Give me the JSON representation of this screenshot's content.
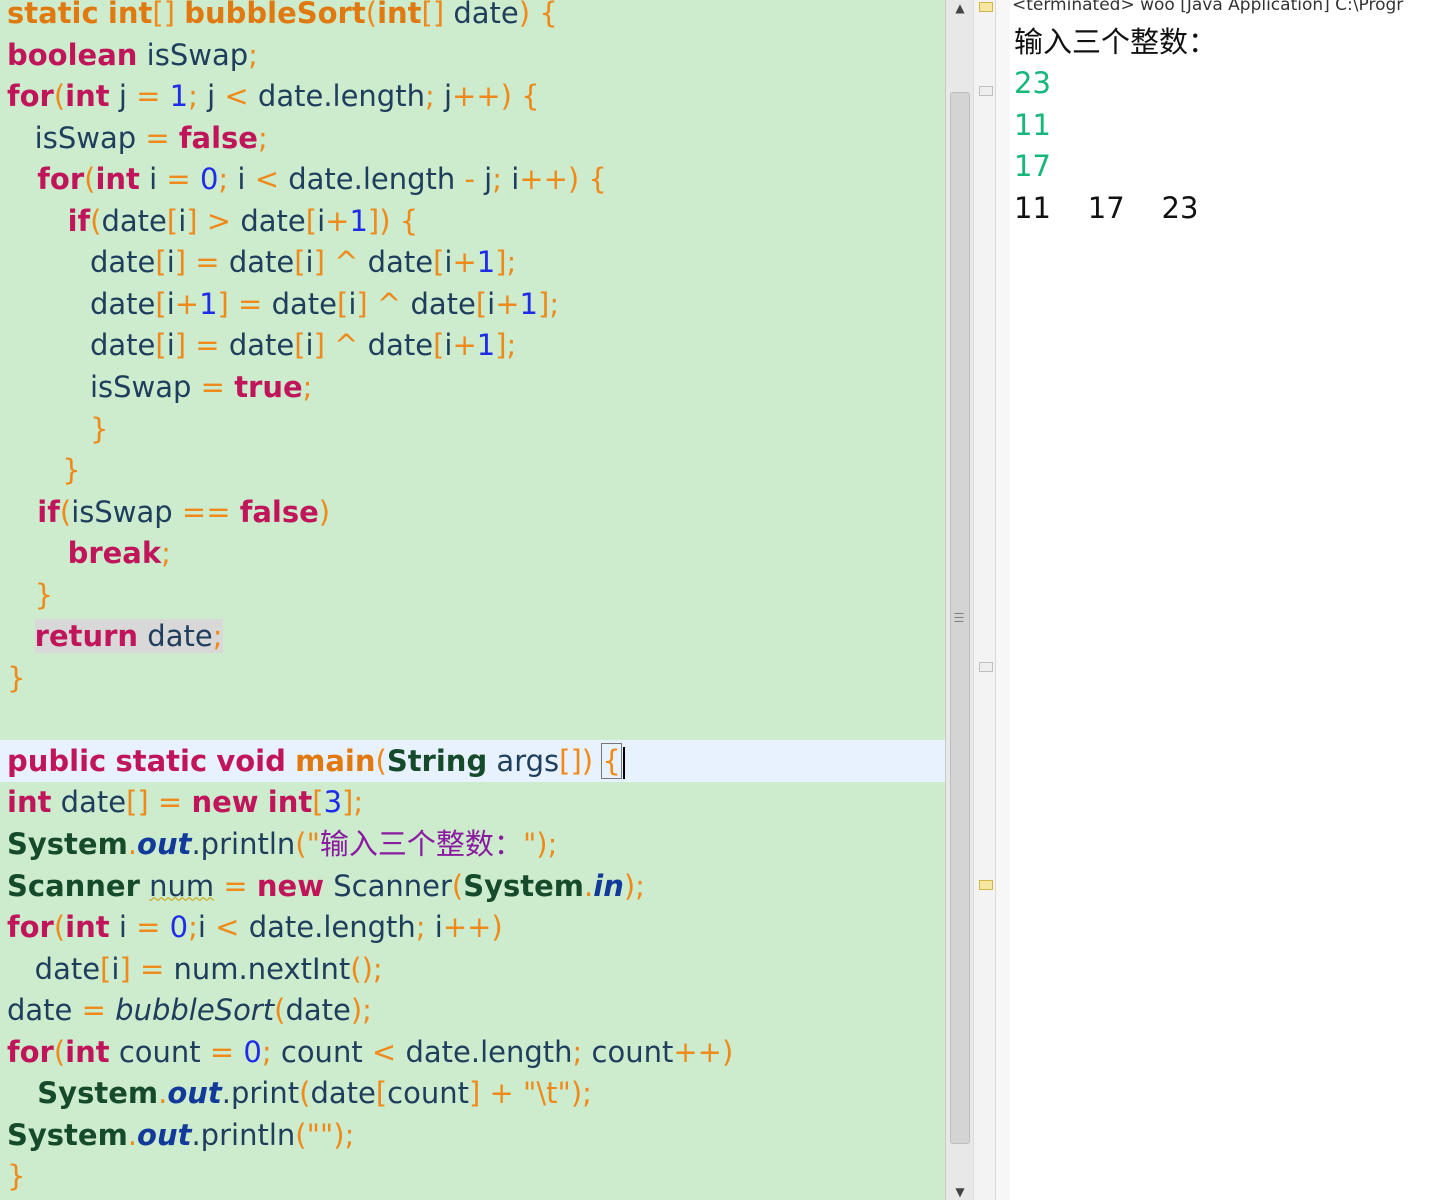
{
  "editor": {
    "lines": [
      [
        [
          "type",
          "static"
        ],
        [
          "p",
          " "
        ],
        [
          "type",
          "int"
        ],
        [
          "p",
          "[] "
        ],
        [
          "fn",
          "bubbleSort"
        ],
        [
          "p",
          "("
        ],
        [
          "type",
          "int"
        ],
        [
          "p",
          "[] "
        ],
        [
          "id",
          "date"
        ],
        [
          "p",
          ") {"
        ]
      ],
      [
        [
          "kw",
          "boolean"
        ],
        [
          "id",
          " isSwap"
        ],
        [
          "p",
          ";"
        ]
      ],
      [
        [
          "kw",
          "for"
        ],
        [
          "p",
          "("
        ],
        [
          "kw",
          "int"
        ],
        [
          "id",
          " j "
        ],
        [
          "p",
          "= "
        ],
        [
          "num",
          "1"
        ],
        [
          "p",
          "; "
        ],
        [
          "id",
          "j "
        ],
        [
          "p",
          "< "
        ],
        [
          "id",
          "date.length"
        ],
        [
          "p",
          "; "
        ],
        [
          "id",
          "j"
        ],
        [
          "p",
          "++) {"
        ]
      ],
      [
        [
          "id",
          "   isSwap "
        ],
        [
          "p",
          "= "
        ],
        [
          "kw",
          "false"
        ],
        [
          "p",
          ";"
        ]
      ],
      [
        [
          "kw",
          "   for"
        ],
        [
          "p",
          "("
        ],
        [
          "kw",
          "int"
        ],
        [
          "id",
          " i "
        ],
        [
          "p",
          "= "
        ],
        [
          "num",
          "0"
        ],
        [
          "p",
          "; "
        ],
        [
          "id",
          "i "
        ],
        [
          "p",
          "< "
        ],
        [
          "id",
          "date.length "
        ],
        [
          "p",
          "- "
        ],
        [
          "id",
          "j"
        ],
        [
          "p",
          "; "
        ],
        [
          "id",
          "i"
        ],
        [
          "p",
          "++) {"
        ]
      ],
      [
        [
          "kw",
          "      if"
        ],
        [
          "p",
          "("
        ],
        [
          "id",
          "date"
        ],
        [
          "p",
          "["
        ],
        [
          "id",
          "i"
        ],
        [
          "p",
          "] > "
        ],
        [
          "id",
          "date"
        ],
        [
          "p",
          "["
        ],
        [
          "id",
          "i"
        ],
        [
          "p",
          "+"
        ],
        [
          "num",
          "1"
        ],
        [
          "p",
          "]) {"
        ]
      ],
      [
        [
          "id",
          "         date"
        ],
        [
          "p",
          "["
        ],
        [
          "id",
          "i"
        ],
        [
          "p",
          "] = "
        ],
        [
          "id",
          "date"
        ],
        [
          "p",
          "["
        ],
        [
          "id",
          "i"
        ],
        [
          "p",
          "] ^ "
        ],
        [
          "id",
          "date"
        ],
        [
          "p",
          "["
        ],
        [
          "id",
          "i"
        ],
        [
          "p",
          "+"
        ],
        [
          "num",
          "1"
        ],
        [
          "p",
          "];"
        ]
      ],
      [
        [
          "id",
          "         date"
        ],
        [
          "p",
          "["
        ],
        [
          "id",
          "i"
        ],
        [
          "p",
          "+"
        ],
        [
          "num",
          "1"
        ],
        [
          "p",
          "] = "
        ],
        [
          "id",
          "date"
        ],
        [
          "p",
          "["
        ],
        [
          "id",
          "i"
        ],
        [
          "p",
          "] ^ "
        ],
        [
          "id",
          "date"
        ],
        [
          "p",
          "["
        ],
        [
          "id",
          "i"
        ],
        [
          "p",
          "+"
        ],
        [
          "num",
          "1"
        ],
        [
          "p",
          "];"
        ]
      ],
      [
        [
          "id",
          "         date"
        ],
        [
          "p",
          "["
        ],
        [
          "id",
          "i"
        ],
        [
          "p",
          "] = "
        ],
        [
          "id",
          "date"
        ],
        [
          "p",
          "["
        ],
        [
          "id",
          "i"
        ],
        [
          "p",
          "] ^ "
        ],
        [
          "id",
          "date"
        ],
        [
          "p",
          "["
        ],
        [
          "id",
          "i"
        ],
        [
          "p",
          "+"
        ],
        [
          "num",
          "1"
        ],
        [
          "p",
          "];"
        ]
      ],
      [
        [
          "id",
          "         isSwap "
        ],
        [
          "p",
          "= "
        ],
        [
          "kw",
          "true"
        ],
        [
          "p",
          ";"
        ]
      ],
      [
        [
          "p",
          "         }"
        ]
      ],
      [
        [
          "p",
          "      }"
        ]
      ],
      [
        [
          "kw",
          "   if"
        ],
        [
          "p",
          "("
        ],
        [
          "id",
          "isSwap "
        ],
        [
          "p",
          "== "
        ],
        [
          "kw",
          "false"
        ],
        [
          "p",
          ")"
        ]
      ],
      [
        [
          "kw",
          "      break"
        ],
        [
          "p",
          ";"
        ]
      ],
      [
        [
          "p",
          "   }"
        ]
      ],
      [
        [
          "hlkw",
          "   return"
        ],
        [
          "hl",
          " date"
        ],
        [
          "hlp",
          ";"
        ]
      ],
      [
        [
          "p",
          "}"
        ]
      ],
      [],
      [
        [
          "kw",
          "public"
        ],
        [
          "id",
          " "
        ],
        [
          "kw",
          "static"
        ],
        [
          "id",
          " "
        ],
        [
          "kw",
          "void"
        ],
        [
          "id",
          " "
        ],
        [
          "fn",
          "main"
        ],
        [
          "p",
          "("
        ],
        [
          "cls",
          "String"
        ],
        [
          "id",
          " args"
        ],
        [
          "p",
          "[]) "
        ],
        [
          "bracket",
          "{"
        ],
        [
          "caret",
          ""
        ]
      ],
      [
        [
          "kw",
          "int"
        ],
        [
          "id",
          " date"
        ],
        [
          "p",
          "[] = "
        ],
        [
          "kw",
          "new"
        ],
        [
          "id",
          " "
        ],
        [
          "kw",
          "int"
        ],
        [
          "p",
          "["
        ],
        [
          "num",
          "3"
        ],
        [
          "p",
          "];"
        ]
      ],
      [
        [
          "cls",
          "System"
        ],
        [
          "p",
          "."
        ],
        [
          "fld",
          "out"
        ],
        [
          "id",
          ".println"
        ],
        [
          "p",
          "(\""
        ],
        [
          "str",
          "输入三个整数："
        ],
        [
          "p",
          "\");"
        ]
      ],
      [
        [
          "cls",
          "Scanner"
        ],
        [
          "id",
          " "
        ],
        [
          "squig",
          "num"
        ],
        [
          "id",
          " "
        ],
        [
          "p",
          "= "
        ],
        [
          "kw",
          "new"
        ],
        [
          "id",
          " Scanner"
        ],
        [
          "p",
          "("
        ],
        [
          "cls",
          "System"
        ],
        [
          "p",
          "."
        ],
        [
          "fld",
          "in"
        ],
        [
          "p",
          ");"
        ]
      ],
      [
        [
          "kw",
          "for"
        ],
        [
          "p",
          "("
        ],
        [
          "kw",
          "int"
        ],
        [
          "id",
          " i "
        ],
        [
          "p",
          "= "
        ],
        [
          "num",
          "0"
        ],
        [
          "p",
          ";"
        ],
        [
          "id",
          "i "
        ],
        [
          "p",
          "< "
        ],
        [
          "id",
          "date.length"
        ],
        [
          "p",
          "; "
        ],
        [
          "id",
          "i"
        ],
        [
          "p",
          "++)"
        ]
      ],
      [
        [
          "id",
          "   date"
        ],
        [
          "p",
          "["
        ],
        [
          "id",
          "i"
        ],
        [
          "p",
          "] = "
        ],
        [
          "id",
          "num.nextInt"
        ],
        [
          "p",
          "();"
        ]
      ],
      [
        [
          "id",
          "date "
        ],
        [
          "p",
          "= "
        ],
        [
          "italic",
          "bubbleSort"
        ],
        [
          "p",
          "("
        ],
        [
          "id",
          "date"
        ],
        [
          "p",
          ");"
        ]
      ],
      [
        [
          "kw",
          "for"
        ],
        [
          "p",
          "("
        ],
        [
          "kw",
          "int"
        ],
        [
          "id",
          " count "
        ],
        [
          "p",
          "= "
        ],
        [
          "num",
          "0"
        ],
        [
          "p",
          "; "
        ],
        [
          "id",
          "count "
        ],
        [
          "p",
          "< "
        ],
        [
          "id",
          "date.length"
        ],
        [
          "p",
          "; "
        ],
        [
          "id",
          "count"
        ],
        [
          "p",
          "++)"
        ]
      ],
      [
        [
          "cls",
          "   System"
        ],
        [
          "p",
          "."
        ],
        [
          "fld",
          "out"
        ],
        [
          "id",
          ".print"
        ],
        [
          "p",
          "("
        ],
        [
          "id",
          "date"
        ],
        [
          "p",
          "["
        ],
        [
          "id",
          "count"
        ],
        [
          "p",
          "] + \"\\t\");"
        ]
      ],
      [
        [
          "cls",
          "System"
        ],
        [
          "p",
          "."
        ],
        [
          "fld",
          "out"
        ],
        [
          "id",
          ".println"
        ],
        [
          "p",
          "(\"\");"
        ]
      ],
      [
        [
          "p",
          "}"
        ]
      ]
    ]
  },
  "console": {
    "title": "<terminated> woo [Java Application] C:\\Progr",
    "prompt": "输入三个整数：",
    "inputs": [
      "23",
      "11",
      "17"
    ],
    "output": "11    17    23"
  },
  "colors": {
    "editor_bg": "#cdeccd",
    "keyword": "#c0155a",
    "number": "#1f2ce8",
    "console_input": "#15b77a"
  }
}
